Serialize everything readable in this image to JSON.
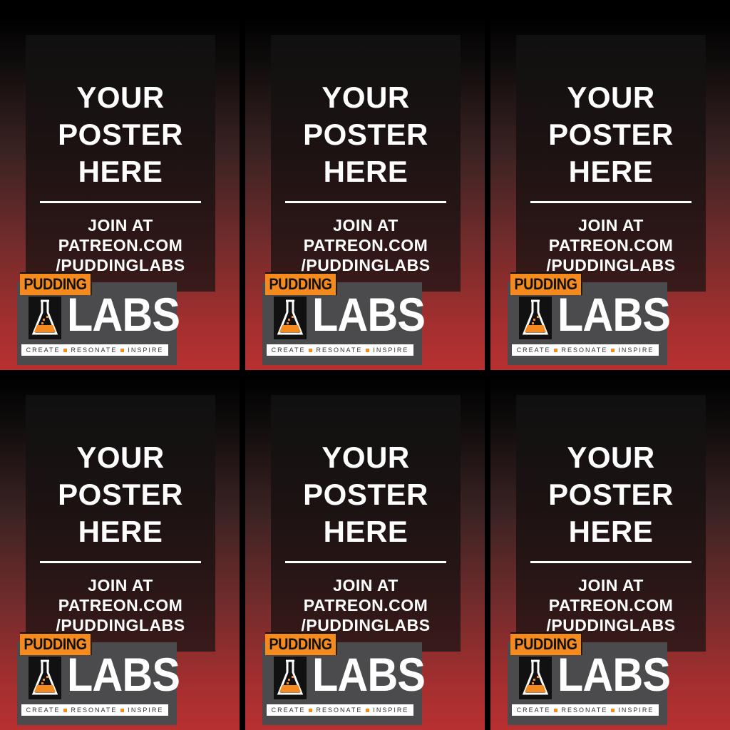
{
  "posters": [
    {
      "title_1": "YOUR",
      "title_2": "POSTER",
      "title_3": "HERE",
      "join_1": "JOIN AT",
      "join_2": "PATREON.COM",
      "join_3": "/PUDDINGLABS",
      "logo_top": "PUDDING",
      "logo_main": "LABS",
      "tag_1": "CREATE",
      "tag_2": "RESONATE",
      "tag_3": "INSPIRE"
    },
    {
      "title_1": "YOUR",
      "title_2": "POSTER",
      "title_3": "HERE",
      "join_1": "JOIN AT",
      "join_2": "PATREON.COM",
      "join_3": "/PUDDINGLABS",
      "logo_top": "PUDDING",
      "logo_main": "LABS",
      "tag_1": "CREATE",
      "tag_2": "RESONATE",
      "tag_3": "INSPIRE"
    },
    {
      "title_1": "YOUR",
      "title_2": "POSTER",
      "title_3": "HERE",
      "join_1": "JOIN AT",
      "join_2": "PATREON.COM",
      "join_3": "/PUDDINGLABS",
      "logo_top": "PUDDING",
      "logo_main": "LABS",
      "tag_1": "CREATE",
      "tag_2": "RESONATE",
      "tag_3": "INSPIRE"
    },
    {
      "title_1": "YOUR",
      "title_2": "POSTER",
      "title_3": "HERE",
      "join_1": "JOIN AT",
      "join_2": "PATREON.COM",
      "join_3": "/PUDDINGLABS",
      "logo_top": "PUDDING",
      "logo_main": "LABS",
      "tag_1": "CREATE",
      "tag_2": "RESONATE",
      "tag_3": "INSPIRE"
    },
    {
      "title_1": "YOUR",
      "title_2": "POSTER",
      "title_3": "HERE",
      "join_1": "JOIN AT",
      "join_2": "PATREON.COM",
      "join_3": "/PUDDINGLABS",
      "logo_top": "PUDDING",
      "logo_main": "LABS",
      "tag_1": "CREATE",
      "tag_2": "RESONATE",
      "tag_3": "INSPIRE"
    },
    {
      "title_1": "YOUR",
      "title_2": "POSTER",
      "title_3": "HERE",
      "join_1": "JOIN AT",
      "join_2": "PATREON.COM",
      "join_3": "/PUDDINGLABS",
      "logo_top": "PUDDING",
      "logo_main": "LABS",
      "tag_1": "CREATE",
      "tag_2": "RESONATE",
      "tag_3": "INSPIRE"
    }
  ],
  "colors": {
    "accent": "#f58a1f",
    "poster_bottom": "#b83030",
    "logo_box": "#4b4b4d"
  },
  "icons": {
    "logo_icon": "flask-icon"
  }
}
